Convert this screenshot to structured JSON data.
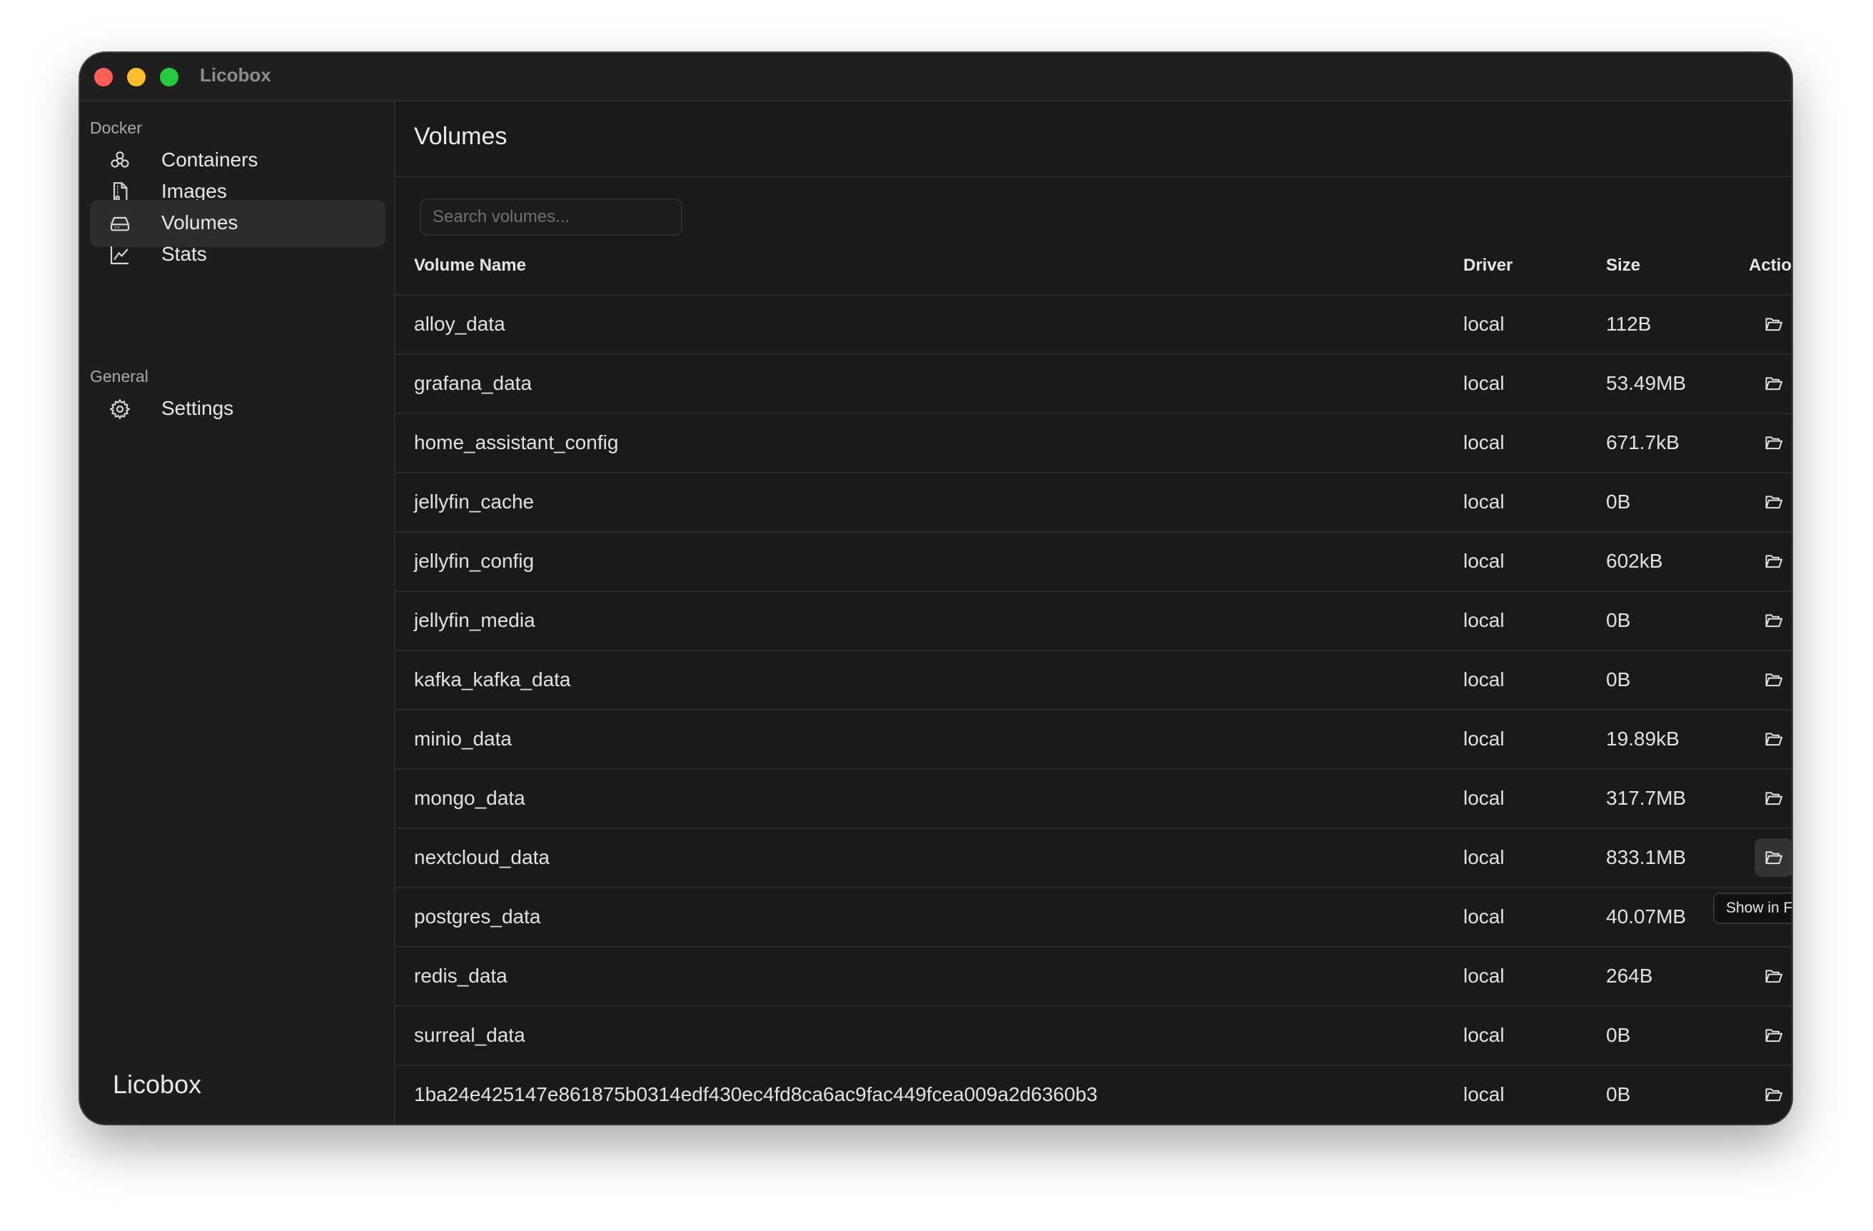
{
  "window": {
    "app_title": "Licobox"
  },
  "sidebar": {
    "sections": [
      {
        "label": "Docker",
        "items": [
          {
            "label": "Containers",
            "icon": "containers-icon",
            "active": false
          },
          {
            "label": "Images",
            "icon": "images-icon",
            "active": false
          },
          {
            "label": "Volumes",
            "icon": "volumes-icon",
            "active": true
          },
          {
            "label": "Stats",
            "icon": "stats-icon",
            "active": false
          }
        ]
      },
      {
        "label": "General",
        "items": [
          {
            "label": "Settings",
            "icon": "gear-icon",
            "active": false
          }
        ]
      }
    ],
    "footer": "Licobox"
  },
  "main": {
    "title": "Volumes",
    "search": {
      "placeholder": "Search volumes...",
      "value": ""
    },
    "table": {
      "columns": [
        "Volume Name",
        "Driver",
        "Size",
        "Actions"
      ],
      "rows": [
        {
          "name": "alloy_data",
          "driver": "local",
          "size": "112B"
        },
        {
          "name": "grafana_data",
          "driver": "local",
          "size": "53.49MB"
        },
        {
          "name": "home_assistant_config",
          "driver": "local",
          "size": "671.7kB"
        },
        {
          "name": "jellyfin_cache",
          "driver": "local",
          "size": "0B"
        },
        {
          "name": "jellyfin_config",
          "driver": "local",
          "size": "602kB"
        },
        {
          "name": "jellyfin_media",
          "driver": "local",
          "size": "0B"
        },
        {
          "name": "kafka_kafka_data",
          "driver": "local",
          "size": "0B"
        },
        {
          "name": "minio_data",
          "driver": "local",
          "size": "19.89kB"
        },
        {
          "name": "mongo_data",
          "driver": "local",
          "size": "317.7MB"
        },
        {
          "name": "nextcloud_data",
          "driver": "local",
          "size": "833.1MB"
        },
        {
          "name": "postgres_data",
          "driver": "local",
          "size": "40.07MB"
        },
        {
          "name": "redis_data",
          "driver": "local",
          "size": "264B"
        },
        {
          "name": "surreal_data",
          "driver": "local",
          "size": "0B"
        },
        {
          "name": "1ba24e425147e861875b0314edf430ec4fd8ca6ac9fac449fcea009a2d6360b3",
          "driver": "local",
          "size": "0B"
        }
      ],
      "row_actions": {
        "folder_icon": "folder-open-icon",
        "delete_icon": "trash-icon"
      }
    },
    "tooltip": {
      "text": "Show in Finder",
      "row_index": 9
    }
  },
  "colors": {
    "window_bg": "#1d1d1d",
    "main_bg": "#1a1a1a",
    "active_item_bg": "#2d2d2d",
    "close": "#ff5f57",
    "minimize": "#febc2e",
    "zoom": "#28c840"
  }
}
